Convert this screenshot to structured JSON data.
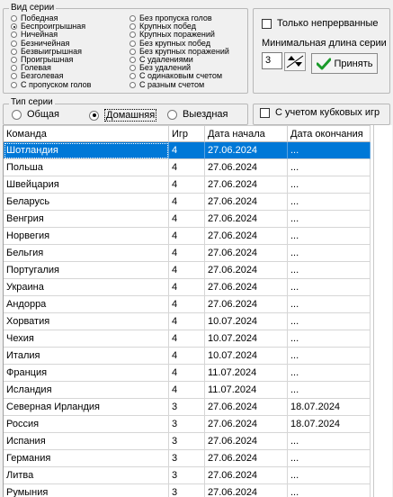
{
  "series_group": {
    "title": "Вид серии",
    "left_options": [
      "Победная",
      "Беспроигрышная",
      "Ничейная",
      "Безничейная",
      "Безвыигрышная",
      "Проигрышная",
      "Голевая",
      "Безголевая",
      "С пропуском голов"
    ],
    "right_options": [
      "Без пропуска голов",
      "Крупных побед",
      "Крупных поражений",
      "Без крупных побед",
      "Без крупных поражений",
      "С удалениями",
      "Без удалений",
      "С одинаковым счетом",
      "С разным счетом"
    ],
    "selected_left_index": 1
  },
  "settings": {
    "only_continuous_label": "Только непрерванные",
    "min_length_label": "Минимальная длина серии",
    "min_length_value": "3",
    "accept_label": "Принять"
  },
  "type_group": {
    "title": "Тип серии",
    "options": [
      "Общая",
      "Домашняя",
      "Выездная"
    ],
    "selected_index": 1
  },
  "cups_label": "С учетом кубковых игр",
  "table": {
    "headers": [
      "Команда",
      "Игр",
      "Дата начала",
      "Дата окончания"
    ],
    "rows": [
      [
        "Шотландия",
        "4",
        "27.06.2024",
        "..."
      ],
      [
        "Польша",
        "4",
        "27.06.2024",
        "..."
      ],
      [
        "Швейцария",
        "4",
        "27.06.2024",
        "..."
      ],
      [
        "Беларусь",
        "4",
        "27.06.2024",
        "..."
      ],
      [
        "Венгрия",
        "4",
        "27.06.2024",
        "..."
      ],
      [
        "Норвегия",
        "4",
        "27.06.2024",
        "..."
      ],
      [
        "Бельгия",
        "4",
        "27.06.2024",
        "..."
      ],
      [
        "Португалия",
        "4",
        "27.06.2024",
        "..."
      ],
      [
        "Украина",
        "4",
        "27.06.2024",
        "..."
      ],
      [
        "Андорра",
        "4",
        "27.06.2024",
        "..."
      ],
      [
        "Хорватия",
        "4",
        "10.07.2024",
        "..."
      ],
      [
        "Чехия",
        "4",
        "10.07.2024",
        "..."
      ],
      [
        "Италия",
        "4",
        "10.07.2024",
        "..."
      ],
      [
        "Франция",
        "4",
        "11.07.2024",
        "..."
      ],
      [
        "Исландия",
        "4",
        "11.07.2024",
        "..."
      ],
      [
        "Северная Ирландия",
        "3",
        "27.06.2024",
        "18.07.2024"
      ],
      [
        "Россия",
        "3",
        "27.06.2024",
        "18.07.2024"
      ],
      [
        "Испания",
        "3",
        "27.06.2024",
        "..."
      ],
      [
        "Германия",
        "3",
        "27.06.2024",
        "..."
      ],
      [
        "Литва",
        "3",
        "27.06.2024",
        "..."
      ],
      [
        "Румыния",
        "3",
        "27.06.2024",
        "..."
      ]
    ],
    "selected_row": 0
  }
}
